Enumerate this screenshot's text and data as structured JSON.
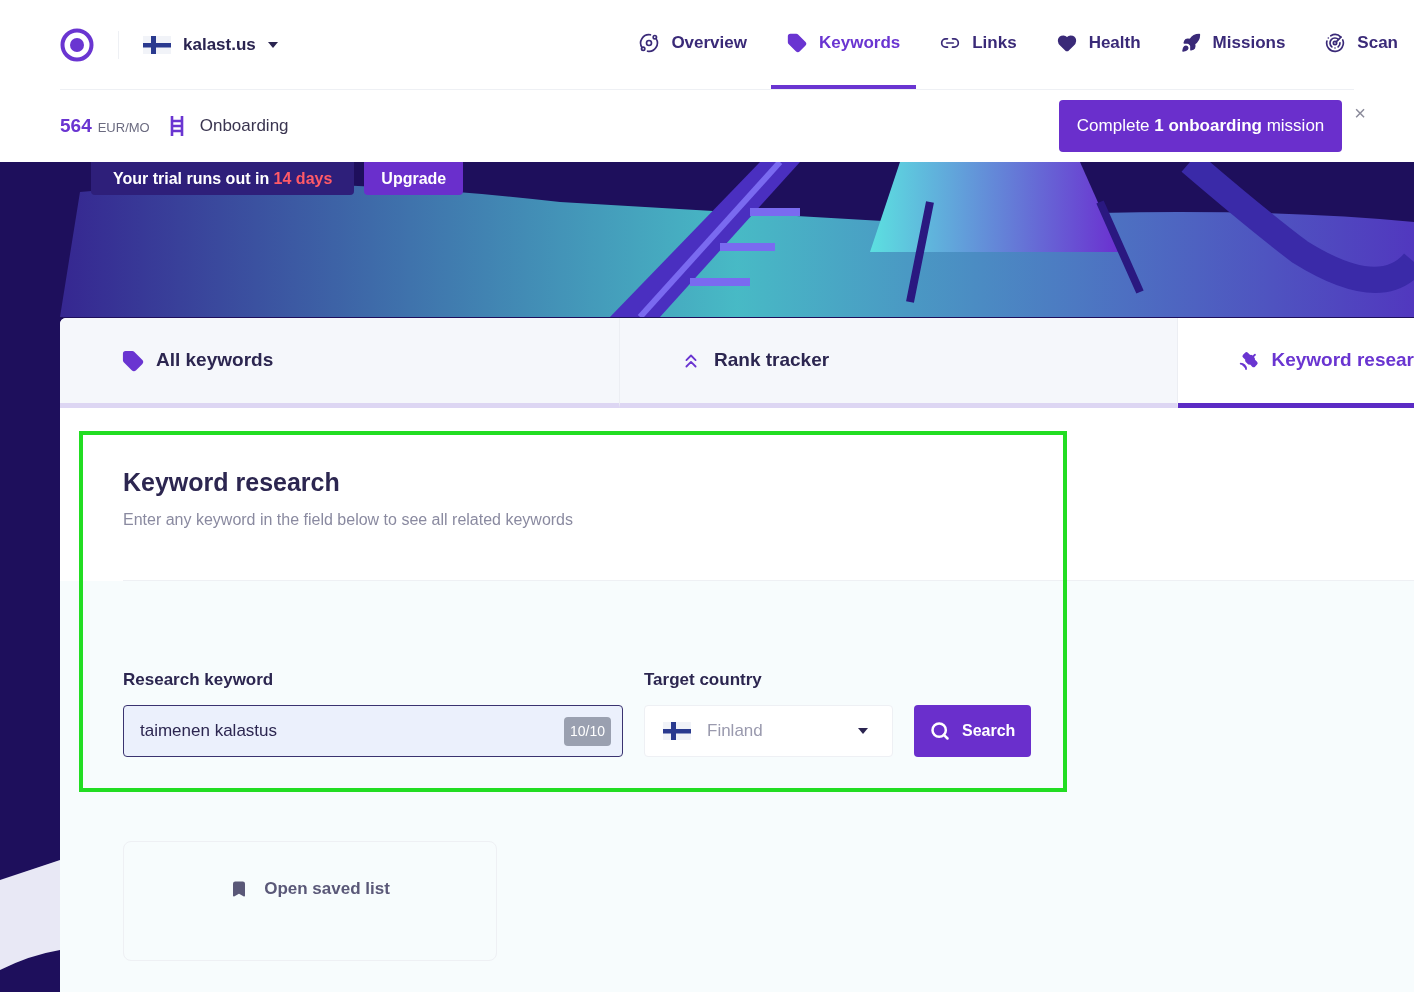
{
  "header": {
    "site": "kalast.us",
    "nav": [
      {
        "label": "Overview",
        "selected": false
      },
      {
        "label": "Keywords",
        "selected": true
      },
      {
        "label": "Links",
        "selected": false
      },
      {
        "label": "Health",
        "selected": false
      },
      {
        "label": "Missions",
        "selected": false
      },
      {
        "label": "Scan",
        "selected": false
      }
    ]
  },
  "subbar": {
    "amount": "564",
    "unit": "EUR/MO",
    "onboarding": "Onboarding",
    "mission_button": "Complete **1 onboarding** mission",
    "close": "×"
  },
  "trial": {
    "text": "Your trial runs out in",
    "days": "14 days",
    "upgrade": "Upgrade"
  },
  "tabs": [
    {
      "label": "All keywords",
      "selected": false
    },
    {
      "label": "Rank tracker",
      "selected": false
    },
    {
      "label": "Keyword resear",
      "selected": true
    }
  ],
  "research": {
    "title": "Keyword research",
    "subtitle": "Enter any keyword in the field below to see all related keywords",
    "keyword_label": "Research keyword",
    "keyword_value": "taimenen kalastus",
    "counter": "10/10",
    "country_label": "Target country",
    "country": "Finland",
    "search": "Search"
  },
  "saved": {
    "label": "Open saved list"
  }
}
